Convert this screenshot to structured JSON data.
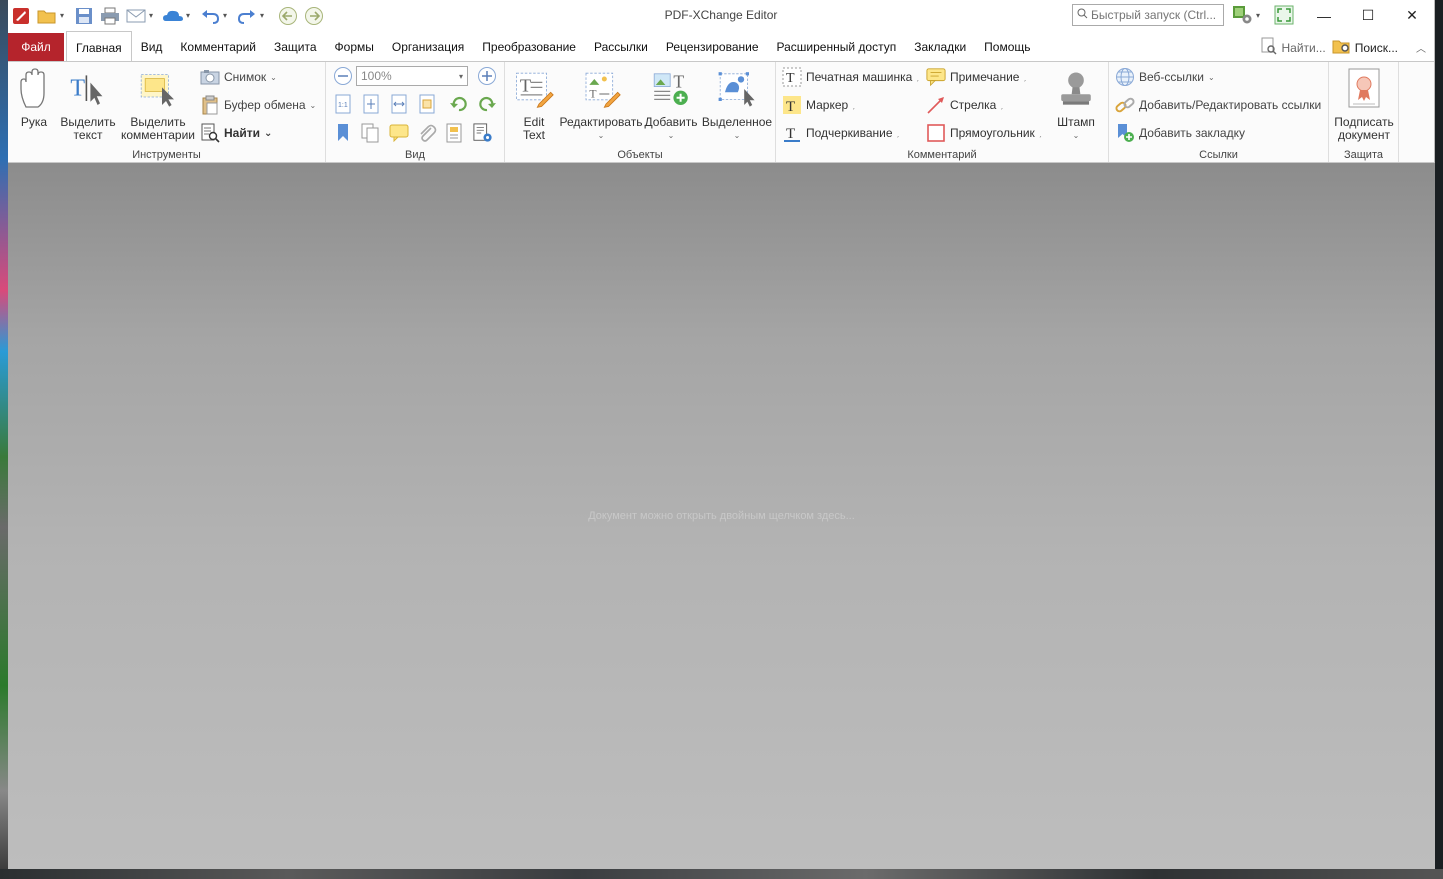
{
  "window": {
    "title": "PDF-XChange Editor",
    "quick_launch_placeholder": "Быстрый запуск (Ctrl...",
    "controls": {
      "minimize": "—",
      "maximize": "☐",
      "close": "✕"
    }
  },
  "tabs": {
    "file": "Файл",
    "items": [
      "Главная",
      "Вид",
      "Комментарий",
      "Защита",
      "Формы",
      "Организация",
      "Преобразование",
      "Рассылки",
      "Рецензирование",
      "Расширенный доступ",
      "Закладки",
      "Помощь"
    ],
    "active": "Главная",
    "right": {
      "find": "Найти...",
      "search": "Поиск..."
    }
  },
  "ribbon": {
    "tools": {
      "label": "Инструменты",
      "hand": "Рука",
      "select_text": "Выделить\nтекст",
      "select_comments": "Выделить\nкомментарии",
      "snapshot": "Снимок",
      "clipboard": "Буфер обмена",
      "find": "Найти"
    },
    "view": {
      "label": "Вид",
      "zoom": "100%"
    },
    "objects": {
      "label": "Объекты",
      "edit_text": "Edit\nText",
      "edit": "Редактировать",
      "add": "Добавить",
      "selected": "Выделенное"
    },
    "comment": {
      "label": "Комментарий",
      "typewriter": "Печатная машинка",
      "highlight": "Маркер",
      "underline": "Подчеркивание",
      "note": "Примечание",
      "arrow": "Стрелка",
      "rectangle": "Прямоугольник",
      "stamp": "Штамп"
    },
    "links": {
      "label": "Ссылки",
      "web_links": "Веб-ссылки",
      "add_edit_links": "Добавить/Редактировать ссылки",
      "add_bookmark": "Добавить закладку"
    },
    "protect": {
      "label": "Защита",
      "sign": "Подписать\nдокумент"
    }
  },
  "workspace": {
    "hint": "Документ можно открыть двойным щелчком здесь..."
  }
}
